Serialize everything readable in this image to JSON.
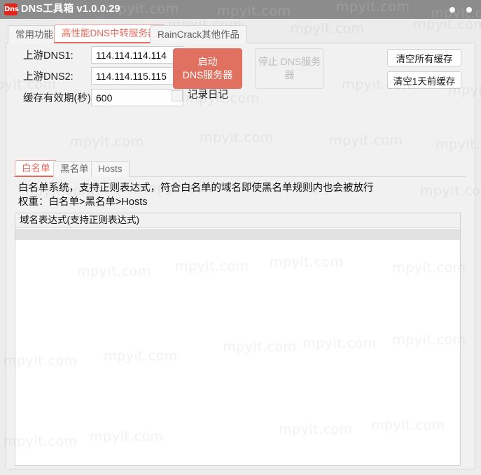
{
  "window": {
    "logo_text": "Dns",
    "title": "DNS工具箱 v1.0.0.29",
    "minimize_label": "",
    "close_label": ""
  },
  "watermark": {
    "text": "mpyit.com"
  },
  "tabs": [
    {
      "label": "常用功能",
      "active": false
    },
    {
      "label": "高性能DNS中转服务器",
      "active": true
    },
    {
      "label": "RainCrack其他作品",
      "active": false
    }
  ],
  "form": {
    "dns1_label": "上游DNS1:",
    "dns1_value": "114.114.114.114",
    "dns1_placeholder": "",
    "dns2_label": "上游DNS2:",
    "dns2_value": "114.114.115.115",
    "dns2_placeholder": "",
    "ttl_label": "缓存有效期(秒)",
    "ttl_value": "600",
    "ttl_placeholder": "",
    "log_checkbox_label": "记录日记",
    "log_checkbox_checked": false
  },
  "buttons": {
    "start_line1": "启动",
    "start_line2": "DNS服务器",
    "stop_line1": "停止",
    "stop_line2": "DNS服务器",
    "stop_disabled": true,
    "clear_all": "清空所有缓存",
    "clear_oneday": "清空1天前缓存"
  },
  "subtabs": [
    {
      "label": "白名单",
      "active": true
    },
    {
      "label": "黑名单",
      "active": false
    },
    {
      "label": "Hosts",
      "active": false
    }
  ],
  "description": {
    "line1": "白名单系统，支持正则表达式，符合白名单的域名即使黑名单规则内也会被放行",
    "line2": "权重：白名单>黑名单>Hosts"
  },
  "list": {
    "column_header": "域名表达式(支持正则表达式)",
    "rows": []
  },
  "colors": {
    "accent": "#e8695c",
    "start_button": "#e0705f",
    "titlebar": "#8c8c8c",
    "panel": "#f1f1f1",
    "logo_red": "#e2241b"
  }
}
